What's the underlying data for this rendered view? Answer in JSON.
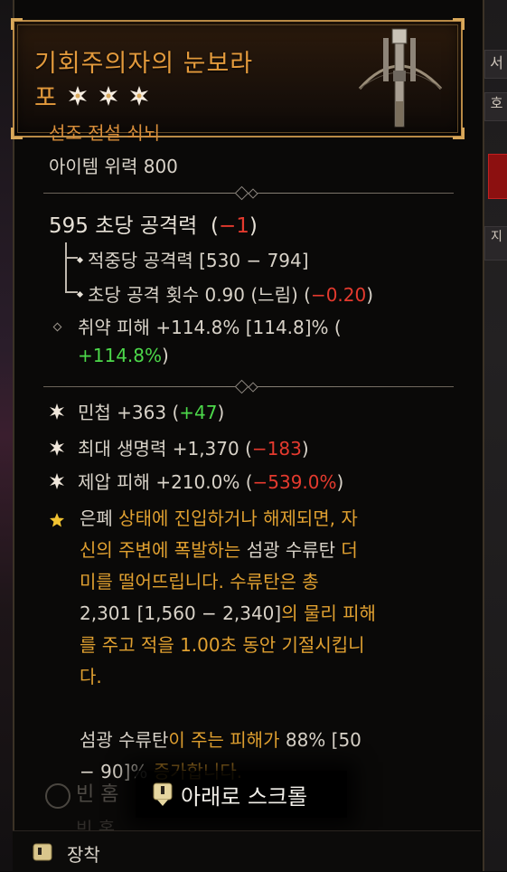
{
  "item": {
    "name_line1": "기회주의자의 눈보라",
    "name_line2": "포",
    "rarity_type": "선조 전설 쇠뇌",
    "item_power": "아이템 위력 800"
  },
  "dps": {
    "value": "595 초당 공격력",
    "open": "(",
    "delta": "−1",
    "close": ")"
  },
  "damage_per_hit": "적중당 공격력 [530 − 794]",
  "attacks_per_second": {
    "text": "초당 공격 횟수 0.90 (느림) (",
    "delta": "−0.20",
    "close": ")"
  },
  "vulnerable": {
    "text": "취약 피해 +114.8% [114.8]% (",
    "delta": "+114.8%",
    "close": ")"
  },
  "affixes": [
    {
      "text": "민첩 +363 (",
      "delta": "+47",
      "close": ")",
      "delta_color": "pos"
    },
    {
      "text": "최대 생명력 +1,370 (",
      "delta": "−183",
      "close": ")",
      "delta_color": "neg"
    },
    {
      "text": "제압 피해 +210.0% (",
      "delta": "−539.0%",
      "close": ")",
      "delta_color": "neg"
    }
  ],
  "legendary": {
    "l1a": "은폐",
    "l1b": " 상태에 진입하거나 해제되면, 자",
    "l2a": "신의 주변에 폭발하는 ",
    "l2b": "섬광 수류탄",
    "l2c": " 더",
    "l3": "미를 떨어뜨립니다. 수류탄은 총",
    "l4a": "2,301 [1,560 − 2,340]",
    "l4b": "의 물리 피해",
    "l5": "를 주고 적을 1.00초 동안 기절시킵니",
    "l6": "다.",
    "l8a": "섬광 수류탄",
    "l8b": "이 주는 피해가 ",
    "l8c": "88% [50",
    "l9a": "− 90]%",
    "l9b": " 증가합니다."
  },
  "socket": "빈 홈",
  "socket2": "빈 홈",
  "scroll_hint": "아래로 스크롤",
  "footer": {
    "equip": "장착"
  },
  "side_tabs": [
    "서",
    "호",
    "지"
  ],
  "colors": {
    "title": "#e39a3c",
    "legendary_orange": "#e0a030",
    "negative": "#e43a2e",
    "positive": "#4cd84a"
  }
}
